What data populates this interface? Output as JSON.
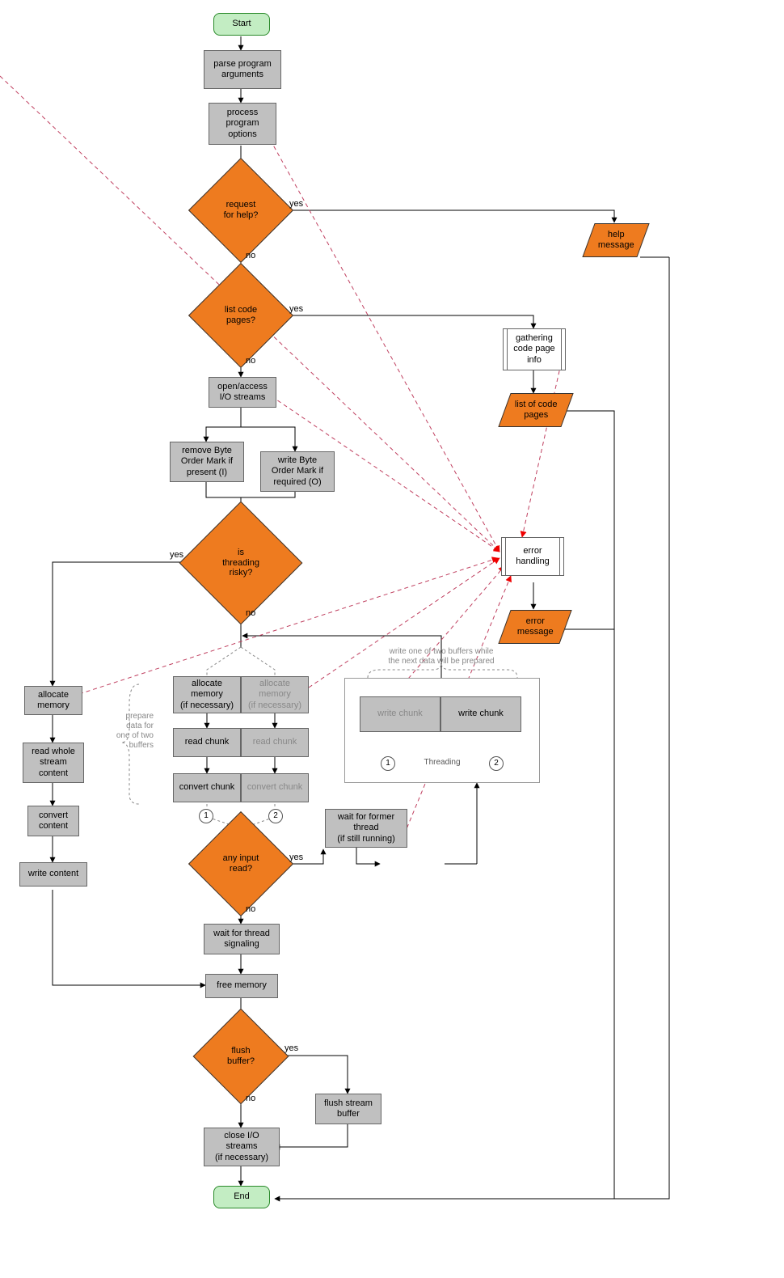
{
  "nodes": {
    "start": "Start",
    "parse_args": "parse program\narguments",
    "process_opts": "process\nprogram\noptions",
    "req_help": "request\nfor help?",
    "list_cp": "list code\npages?",
    "open_io": "open/access\nI/O streams",
    "rm_bom": "remove Byte\nOrder Mark if\npresent (I)",
    "wr_bom": "write Byte\nOrder Mark if\nrequired (O)",
    "thread_risky": "is\nthreading\nrisky?",
    "alloc_left": "allocate\nmemory",
    "read_whole": "read whole\nstream\ncontent",
    "conv_content": "convert\ncontent",
    "write_content": "write content",
    "alloc1": "allocate\nmemory\n(if necessary)",
    "alloc2": "allocate\nmemory\n(if necessary)",
    "rchunk1": "read chunk",
    "rchunk2": "read chunk",
    "cchunk1": "convert chunk",
    "cchunk2": "convert chunk",
    "any_input": "any input\nread?",
    "wait_former": "wait for former\nthread\n(if still running)",
    "wait_signal": "wait for thread\nsignaling",
    "free_mem": "free memory",
    "flush_buf": "flush\nbuffer?",
    "flush_stream": "flush stream\nbuffer",
    "close_io": "close I/O\nstreams\n(if necessary)",
    "end": "End",
    "help_msg": "help\nmessage",
    "gather_cp": "gathering\ncode page\ninfo",
    "list_cp_out": "list of code\npages",
    "err_handling": "error\nhandling",
    "err_msg": "error\nmessage",
    "wchunk1": "write chunk",
    "wchunk2": "write chunk"
  },
  "edge_labels": {
    "yes": "yes",
    "no": "no"
  },
  "annotations": {
    "prepare": "prepare\ndata for\none of two\nbuffers",
    "write_note": "write one of two buffers while\nthe next data will be prepared",
    "threading_label": "Threading"
  },
  "numbers": {
    "one": "1",
    "two": "2"
  }
}
